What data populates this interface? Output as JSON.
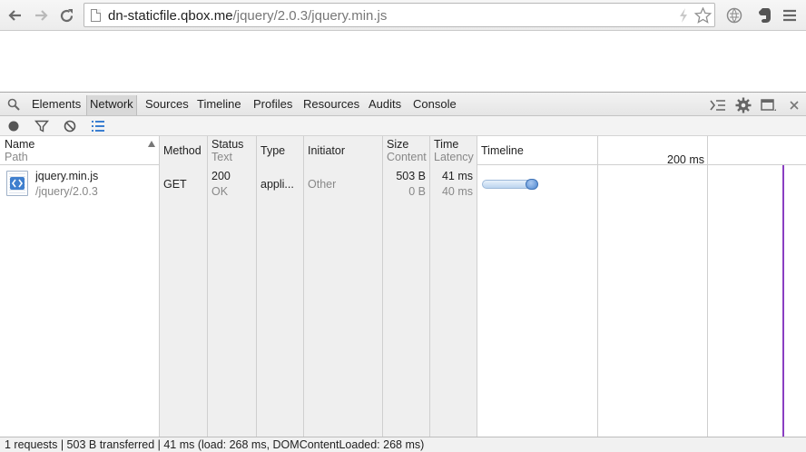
{
  "browser": {
    "url_host": "dn-staticfile.qbox.me",
    "url_path": "/jquery/2.0.3/jquery.min.js"
  },
  "devtools": {
    "tabs": [
      "Elements",
      "Network",
      "Sources",
      "Timeline",
      "Profiles",
      "Resources",
      "Audits",
      "Console"
    ],
    "active_tab": "Network"
  },
  "grid": {
    "headers": {
      "name": "Name",
      "path": "Path",
      "method": "Method",
      "status": "Status",
      "text": "Text",
      "type": "Type",
      "initiator": "Initiator",
      "size": "Size",
      "content": "Content",
      "time": "Time",
      "latency": "Latency",
      "timeline": "Timeline",
      "scale_label": "200 ms"
    },
    "rows": [
      {
        "name": "jquery.min.js",
        "path": "/jquery/2.0.3",
        "method": "GET",
        "status": "200",
        "status_text": "OK",
        "type": "appli...",
        "initiator": "Other",
        "size": "503 B",
        "content": "0 B",
        "time": "41 ms",
        "latency": "40 ms"
      }
    ]
  },
  "footer": {
    "summary": "1 requests | 503 B transferred | 41 ms (load: 268 ms, DOMContentLoaded: 268 ms)"
  },
  "colors": {
    "load_line": "#8a3fc2",
    "timeline_bar": "#4d86cf"
  }
}
